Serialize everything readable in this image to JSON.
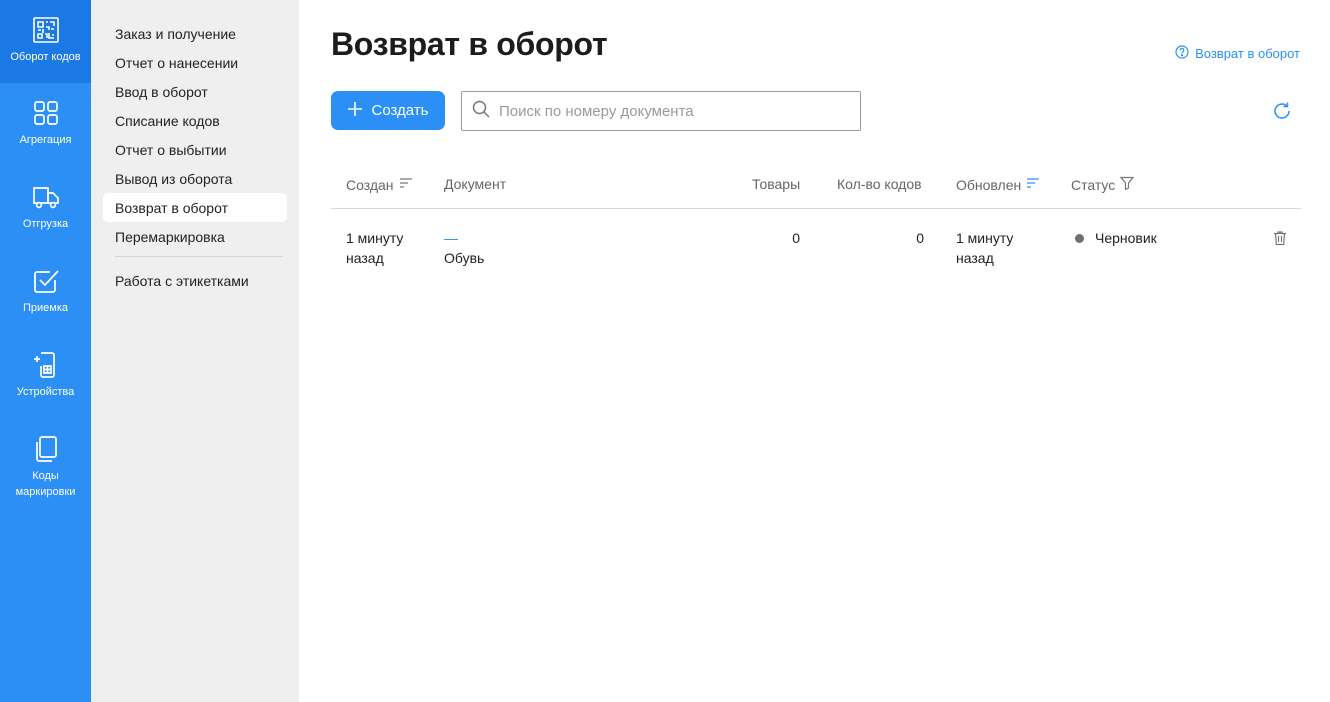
{
  "rail": [
    {
      "icon": "barcode-icon",
      "label": "Оборот кодов",
      "active": true
    },
    {
      "icon": "grid-icon",
      "label": "Агрегация"
    },
    {
      "icon": "truck-icon",
      "label": "Отгрузка"
    },
    {
      "icon": "checkbox-icon",
      "label": "Приемка"
    },
    {
      "icon": "device-icon",
      "label": "Устройства"
    },
    {
      "icon": "copy-icon",
      "label": "Коды маркировки"
    }
  ],
  "subnav": {
    "items": [
      "Заказ и получение",
      "Отчет о нанесении",
      "Ввод в оборот",
      "Списание кодов",
      "Отчет о выбытии",
      "Вывод из оборота",
      "Возврат в оборот",
      "Перемаркировка"
    ],
    "active_index": 6,
    "extra_item": "Работа с этикетками"
  },
  "page": {
    "title": "Возврат в оборот",
    "help_link": "Возврат в оборот",
    "create_label": "Создать",
    "search_placeholder": "Поиск по номеру документа"
  },
  "table": {
    "headers": {
      "created": "Создан",
      "document": "Документ",
      "goods": "Товары",
      "codes": "Кол-во кодов",
      "updated": "Обновлен",
      "status": "Статус"
    },
    "rows": [
      {
        "created_line1": "1 минуту",
        "created_line2": "назад",
        "doc_number": "—",
        "doc_type": "Обувь",
        "goods": "0",
        "codes": "0",
        "updated_line1": "1 минуту",
        "updated_line2": "назад",
        "status": "Черновик"
      }
    ]
  },
  "colors": {
    "brand": "#2b8ff6",
    "rail_active": "#1a79e4",
    "status_draft": "#707070"
  }
}
